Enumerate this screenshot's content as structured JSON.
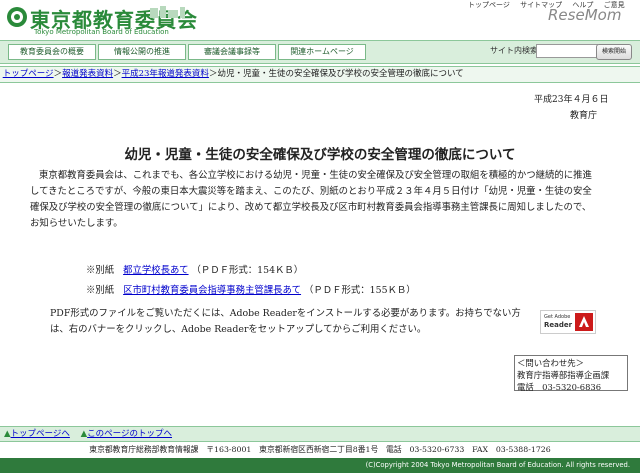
{
  "header": {
    "logo_text": "東京都教育委員会",
    "logo_sub": "Tokyo Metropolitan Board of Education",
    "top_links": [
      "トップページ",
      "サイトマップ",
      "ヘルプ",
      "ご意見"
    ],
    "watermark": "ReseMom"
  },
  "nav": {
    "items": [
      "教育委員会の概要",
      "情報公開の推進",
      "審議会議事録等",
      "関連ホームページ"
    ],
    "search_label": "サイト内検索",
    "search_placeholder": "",
    "search_button": "検索開始"
  },
  "breadcrumb": {
    "items": [
      "トップページ",
      "報道発表資料",
      "平成23年報道発表資料"
    ],
    "current": "幼児・児童・生徒の安全確保及び学校の安全管理の徹底について",
    "separator": "＞"
  },
  "document": {
    "date": "平成23年４月６日",
    "org": "教育庁",
    "title": "幼児・児童・生徒の安全確保及び学校の安全管理の徹底について",
    "body_lines": [
      "東京都教育委員会は、これまでも、各公立学校における幼児・児童・生徒の安全確保及び安全管理の取組を積極的かつ継続的に推進",
      "してきたところですが、今般の東日本大震災等を踏まえ、このたび、別紙のとおり平成２３年４月５日付け「幼児・児童・生徒の安全",
      "確保及び学校の安全管理の徹底について」により、改めて都立学校長及び区市町村教育委員会指導事務主管課長に周知しましたので、",
      "お知らせいたします。"
    ],
    "attachments": [
      {
        "prefix": "※別紙",
        "link": "都立学校長あて",
        "suffix": "（ＰＤＦ形式：154ＫＢ）"
      },
      {
        "prefix": "※別紙",
        "link": "区市町村教育委員会指導事務主管課長あて",
        "suffix": "（ＰＤＦ形式：155ＫＢ）"
      }
    ],
    "pdf_note_lines": [
      "PDF形式のファイルをご覧いただくには、Adobe Readerをインストールする必要があります。お持ちでない方",
      "は、右のバナーをクリックし、Adobe Readerをセットアップしてからご利用ください。"
    ],
    "adobe_banner": {
      "line1": "Get Adobe",
      "line2": "Reader"
    },
    "contact": {
      "title": "＜問い合わせ先＞",
      "dept": "教育庁指導部指導企画課",
      "phone": "電話　03-5320-6836"
    }
  },
  "footer": {
    "links": [
      "トップページへ",
      "このページのトップへ"
    ],
    "address": "東京都教育庁総務部教育情報課　〒163-8001　東京都新宿区西新宿二丁目8番1号　電話　03-5320-6733　FAX　03-5388-1726",
    "copyright": "(C)Copyright 2004 Tokyo Metropolitan Board of Education. All rights reserved."
  },
  "colors": {
    "accent_green": "#2a8a3a",
    "nav_bg": "#d9eedc",
    "link": "#0000cc"
  }
}
